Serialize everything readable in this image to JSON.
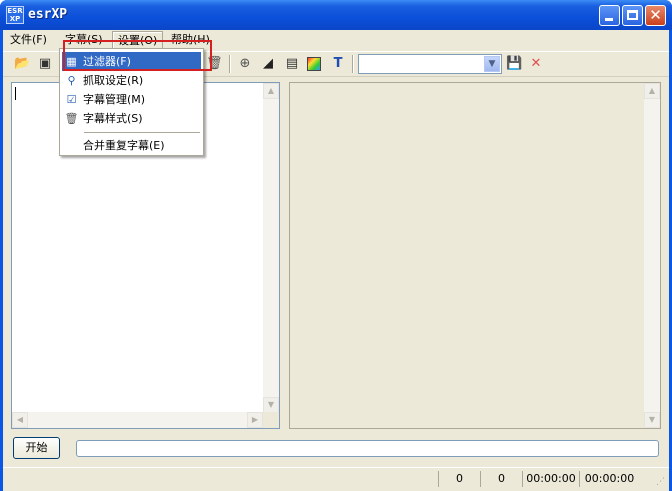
{
  "window": {
    "title": "esrXP",
    "icon_label": "ESR\nXP"
  },
  "icons": {
    "app": "app-icon",
    "minimize": "minimize-icon",
    "maximize": "maximize-icon",
    "close": "close-icon"
  },
  "menubar": {
    "items": [
      {
        "label": "文件(F)"
      },
      {
        "label": "字幕(S)"
      },
      {
        "label": "设置(O)"
      },
      {
        "label": "帮助(H)"
      }
    ]
  },
  "toolbar": {
    "combo_value": "",
    "icon_names": [
      "open-folder-icon",
      "capture-icon",
      "trash-icon",
      "zoom-in-icon",
      "ramp-icon",
      "document-icon",
      "color-icon",
      "text-icon",
      "save-icon",
      "delete-icon"
    ]
  },
  "settings_menu": {
    "items": [
      {
        "label": "过滤器(F)",
        "icon": "filter-icon",
        "highlighted": true
      },
      {
        "label": "抓取设定(R)",
        "icon": "magnifier-icon"
      },
      {
        "label": "字幕管理(M)",
        "icon": "subtitle-manager-icon"
      },
      {
        "label": "字幕样式(S)",
        "icon": "subtitle-style-icon"
      },
      {
        "label": "合并重复字幕(E)",
        "icon": ""
      }
    ]
  },
  "buttons": {
    "start": "开始"
  },
  "progress": {
    "value": 0
  },
  "statusbar": {
    "cells": [
      "0",
      "0",
      "00:00:00",
      "00:00:00"
    ]
  },
  "colors": {
    "titlebar": "#0b4fd9",
    "highlight": "#316ac5",
    "annotation": "#d42020"
  }
}
